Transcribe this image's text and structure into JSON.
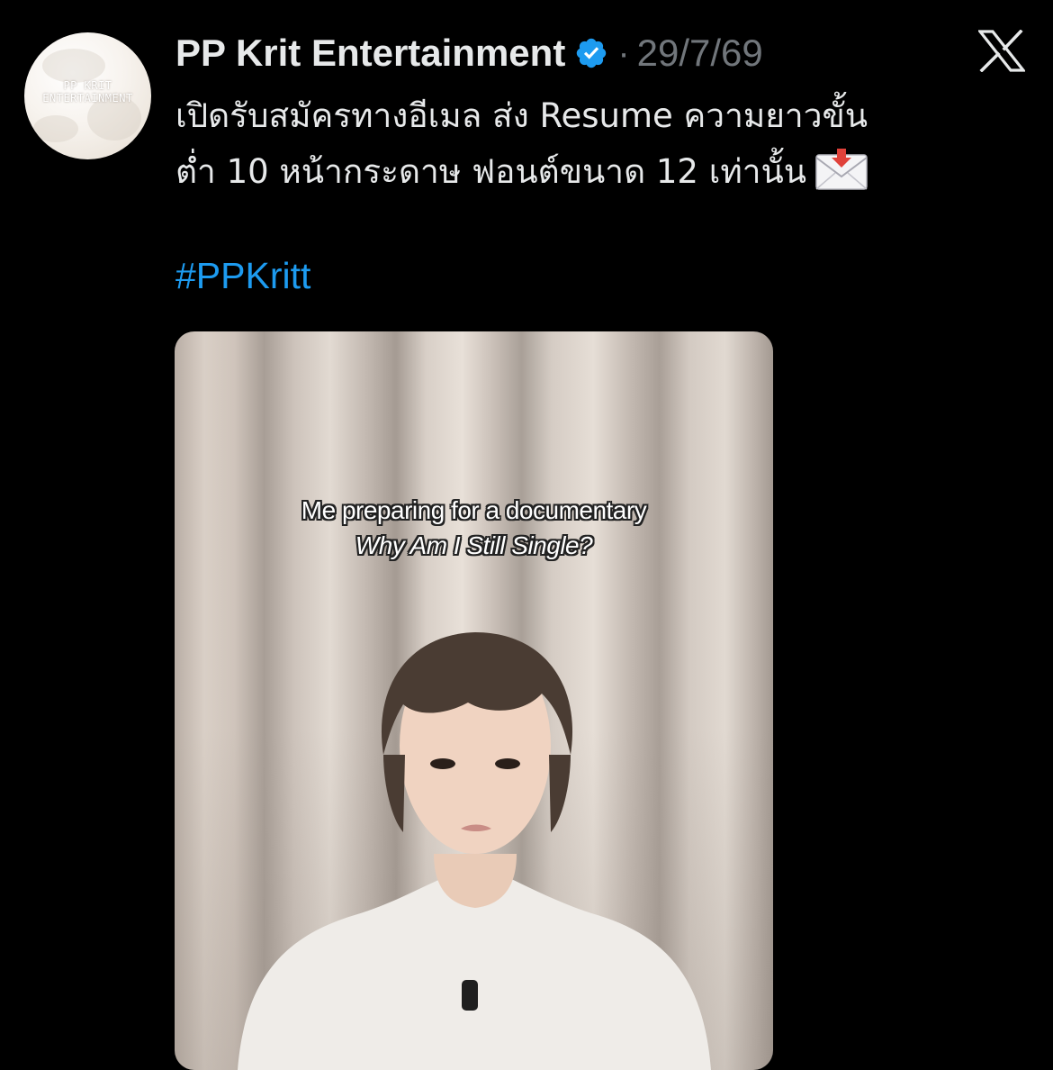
{
  "post": {
    "avatar": {
      "brand_line1": "PP KRIT",
      "brand_line2": "ENTERTAINMENT"
    },
    "author": {
      "display_name": "PP Krit Entertainment",
      "verified": true
    },
    "separator": "·",
    "date": "29/7/69",
    "platform_icon": "x-logo-icon",
    "text_lines": [
      "เปิดรับสมัครทางอีเมล ส่ง Resume ความยาวขั้น",
      "ต่ำ 10 หน้ากระดาษ ฟอนต์ขนาด 12 เท่านั้น"
    ],
    "emoji": "envelope-with-arrow-icon",
    "hashtag": "#PPKritt",
    "media": {
      "caption_line1": "Me preparing for a documentary",
      "caption_line2": "Why Am I Still Single?"
    }
  },
  "colors": {
    "background": "#000000",
    "text": "#e7e9ea",
    "muted": "#71767b",
    "link": "#1d9bf0",
    "verified_badge": "#1d9bf0"
  }
}
